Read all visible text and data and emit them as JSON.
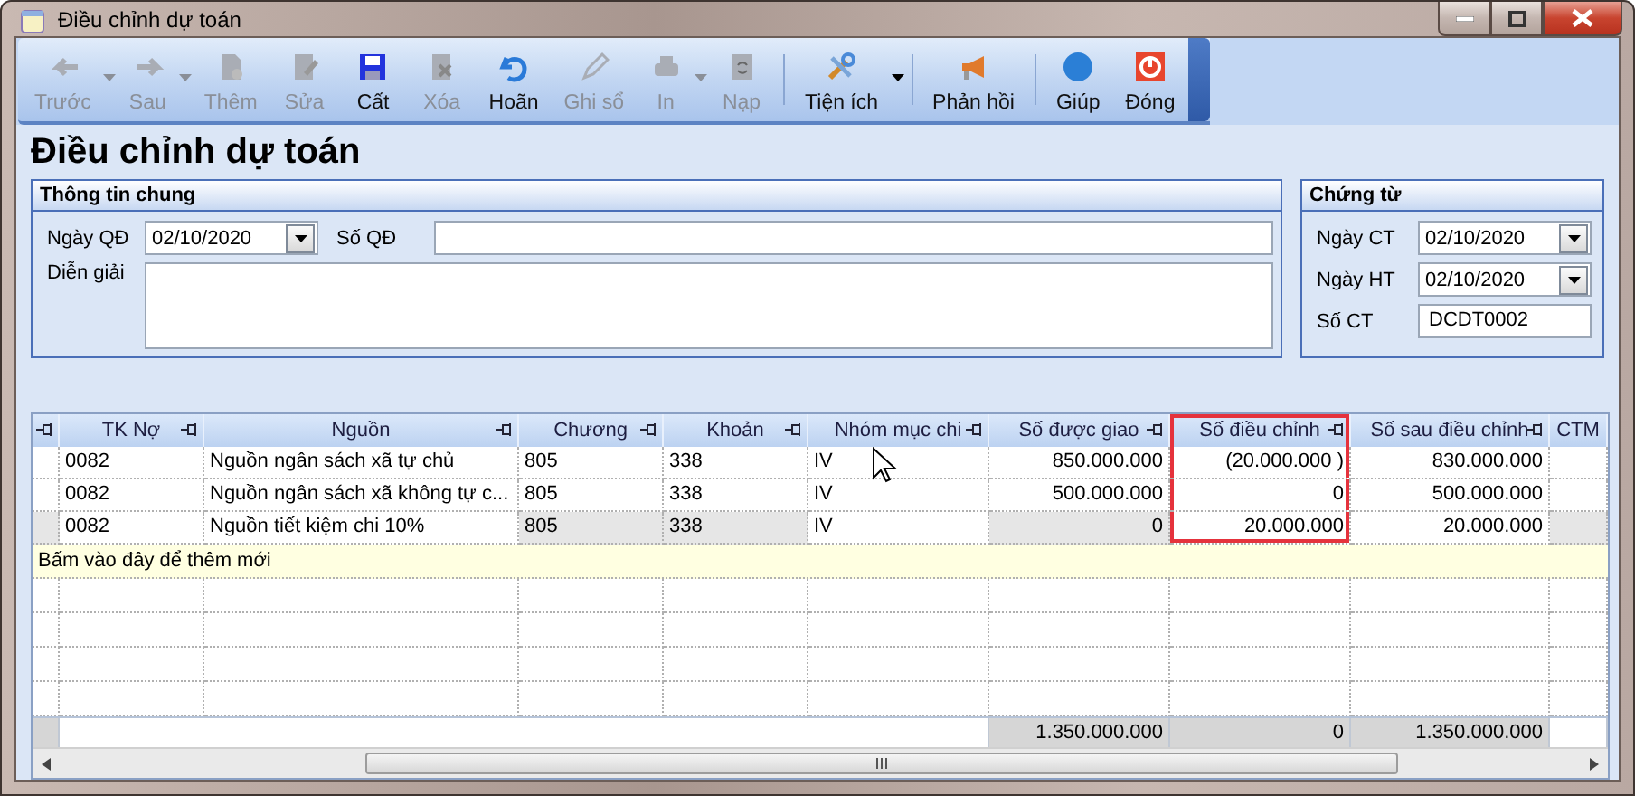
{
  "window": {
    "title": "Điều chỉnh dự toán"
  },
  "toolbar": {
    "groups": [
      [
        {
          "label": "Trước",
          "disabled": true,
          "dropdown": true
        },
        {
          "label": "Sau",
          "disabled": true,
          "dropdown": true
        },
        {
          "label": "Thêm",
          "disabled": true,
          "dropdown": false
        },
        {
          "label": "Sửa",
          "disabled": true,
          "dropdown": false
        },
        {
          "label": "Cất",
          "disabled": false,
          "dropdown": false
        },
        {
          "label": "Xóa",
          "disabled": true,
          "dropdown": false
        },
        {
          "label": "Hoãn",
          "disabled": false,
          "dropdown": false
        },
        {
          "label": "Ghi sổ",
          "disabled": true,
          "dropdown": false
        },
        {
          "label": "In",
          "disabled": true,
          "dropdown": true
        },
        {
          "label": "Nạp",
          "disabled": true,
          "dropdown": false
        }
      ],
      [
        {
          "label": "Tiện ích",
          "disabled": false,
          "dropdown": true
        }
      ],
      [
        {
          "label": "Phản hồi",
          "disabled": false,
          "dropdown": false
        }
      ],
      [
        {
          "label": "Giúp",
          "disabled": false,
          "dropdown": false
        },
        {
          "label": "Đóng",
          "disabled": false,
          "dropdown": false
        }
      ]
    ]
  },
  "heading": "Điều chỉnh dự toán",
  "general": {
    "title": "Thông tin chung",
    "date_label": "Ngày QĐ",
    "date": "02/10/2020",
    "number_label": "Số QĐ",
    "description_label": "Diễn giải"
  },
  "voucher": {
    "title": "Chứng từ",
    "fields": [
      {
        "kind": "date",
        "label": "Ngày CT",
        "value": "02/10/2020"
      },
      {
        "kind": "date",
        "label": "Ngày HT",
        "value": "02/10/2020"
      },
      {
        "kind": "text",
        "label": "Số CT",
        "value": "DCDT0002"
      }
    ]
  },
  "grid": {
    "columns": [
      {
        "label": "TK Nợ",
        "kind": "text",
        "editable": true,
        "highlighted": false
      },
      {
        "label": "Nguồn",
        "kind": "text",
        "editable": true,
        "highlighted": false
      },
      {
        "label": "Chương",
        "kind": "text",
        "editable": false,
        "highlighted": false
      },
      {
        "label": "Khoản",
        "kind": "text",
        "editable": false,
        "highlighted": false
      },
      {
        "label": "Nhóm mục chi",
        "kind": "text",
        "editable": true,
        "highlighted": false
      },
      {
        "label": "Số được giao",
        "kind": "number",
        "editable": false,
        "highlighted": false
      },
      {
        "label": "Số điều chỉnh",
        "kind": "number",
        "editable": true,
        "highlighted": true
      },
      {
        "label": "Số sau điều chỉnh",
        "kind": "number",
        "editable": true,
        "highlighted": false
      },
      {
        "label": "CTM",
        "kind": "text",
        "editable": false,
        "highlighted": false
      }
    ],
    "rows": [
      {
        "selected": false,
        "cells": [
          "0082",
          "Nguồn ngân sách xã tự chủ",
          "805",
          "338",
          "IV",
          "850.000.000",
          "(20.000.000 )",
          "830.000.000",
          ""
        ]
      },
      {
        "selected": false,
        "cells": [
          "0082",
          "Nguồn ngân sách xã không tự c...",
          "805",
          "338",
          "IV",
          "500.000.000",
          "0",
          "500.000.000",
          ""
        ]
      },
      {
        "selected": true,
        "cells": [
          "0082",
          "Nguồn tiết kiệm chi 10%",
          "805",
          "338",
          "IV",
          "0",
          "20.000.000",
          "20.000.000",
          ""
        ]
      }
    ],
    "new_row": "Bấm vào đây để thêm mới",
    "totals": [
      "1.350.000.000",
      "0",
      "1.350.000.000"
    ]
  }
}
